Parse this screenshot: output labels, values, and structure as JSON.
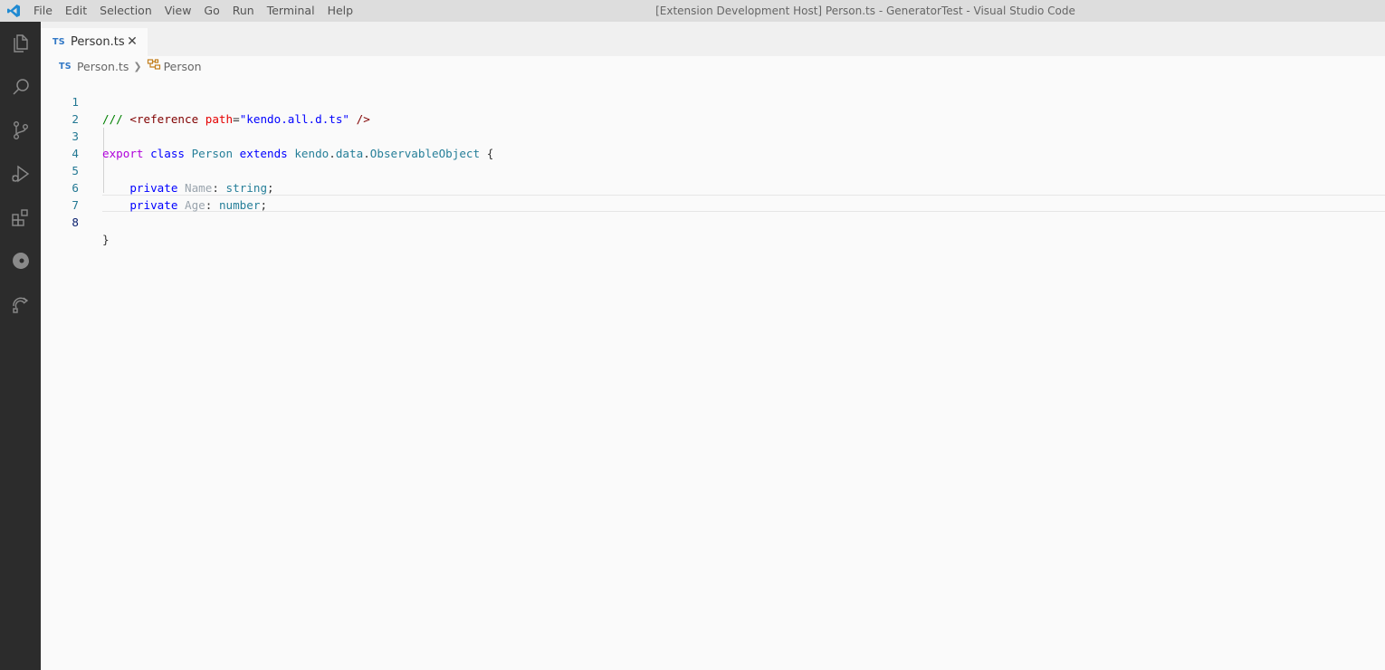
{
  "titlebar": {
    "menu": [
      "File",
      "Edit",
      "Selection",
      "View",
      "Go",
      "Run",
      "Terminal",
      "Help"
    ],
    "window_title": "[Extension Development Host] Person.ts - GeneratorTest - Visual Studio Code",
    "logo_icon": "vscode-logo-icon"
  },
  "activitybar": {
    "items": [
      "explorer-icon",
      "search-icon",
      "source-control-icon",
      "run-debug-icon",
      "extensions-icon",
      "edge-devtools-icon",
      "remote-explorer-icon"
    ]
  },
  "tabs": [
    {
      "badge": "TS",
      "label": "Person.ts",
      "active": true
    }
  ],
  "breadcrumb": {
    "file_badge": "TS",
    "file": "Person.ts",
    "symbol": "Person"
  },
  "editor": {
    "active_line": 8,
    "lines": [
      {
        "n": "1",
        "text": "/// <reference path=\"kendo.all.d.ts\" />"
      },
      {
        "n": "2",
        "text": ""
      },
      {
        "n": "3",
        "text": "export class Person extends kendo.data.ObservableObject {"
      },
      {
        "n": "4",
        "text": ""
      },
      {
        "n": "5",
        "text": "    private Name: string;"
      },
      {
        "n": "6",
        "text": "    private Age: number;"
      },
      {
        "n": "7",
        "text": ""
      },
      {
        "n": "8",
        "text": "}"
      }
    ],
    "tokens": {
      "l1_comment": "/// ",
      "l1_tag_open": "<",
      "l1_tag": "reference",
      "l1_attr": " path",
      "l1_eq": "=",
      "l1_str": "\"kendo.all.d.ts\"",
      "l1_close": " />",
      "l3_export": "export",
      "l3_class": " class ",
      "l3_name": "Person",
      "l3_extends": " extends ",
      "l3_ns1": "kendo",
      "l3_dot1": ".",
      "l3_ns2": "data",
      "l3_dot2": ".",
      "l3_base": "ObservableObject",
      "l3_brace": " {",
      "l5_indent": "    ",
      "l5_private": "private",
      "l5_sp": " ",
      "l5_prop": "Name",
      "l5_colon": ": ",
      "l5_type": "string",
      "l5_semi": ";",
      "l6_indent": "    ",
      "l6_private": "private",
      "l6_sp": " ",
      "l6_prop": "Age",
      "l6_colon": ": ",
      "l6_type": "number",
      "l6_semi": ";",
      "l8_brace": "}"
    }
  },
  "colors": {
    "accent": "#007acc",
    "activitybar": "#2c2c2c",
    "titlebar": "#dddddd",
    "editor_bg": "#fafafa"
  }
}
